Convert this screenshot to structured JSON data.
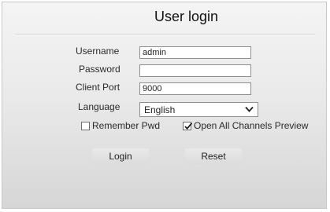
{
  "dialog": {
    "title": "User login"
  },
  "form": {
    "username_label": "Username",
    "username_value": "admin",
    "password_label": "Password",
    "password_value": "",
    "client_port_label": "Client Port",
    "client_port_value": "9000",
    "language_label": "Language",
    "language_value": "English",
    "remember_pwd_label": "Remember Pwd",
    "remember_pwd_checked": false,
    "open_all_channels_label": "Open All Channels Preview",
    "open_all_channels_checked": true
  },
  "actions": {
    "login_label": "Login",
    "reset_label": "Reset"
  },
  "icons": {
    "language_dropdown": "chevron-down-icon",
    "checkmark": "checkmark-icon"
  }
}
